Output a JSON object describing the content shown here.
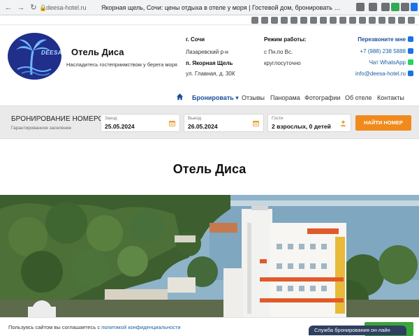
{
  "browser": {
    "url": "deesa-hotel.ru",
    "title": "Якорная щель, Сочи: цены отдыха в отеле у моря | Гостевой дом, бронировать пансион, стоимост..."
  },
  "brand": {
    "logo_text": "DEESA",
    "name": "Отель Диса",
    "tagline": "Насладитесь гостеприимством у берега моря"
  },
  "address": {
    "city": "г. Сочи",
    "district": "Лазаревский р-н",
    "village": "п. Якорная Щель",
    "street": "ул. Главная, д. 30К"
  },
  "hours": {
    "title": "Режим работы:",
    "days": "с Пн.по Вс.",
    "time": "круглосуточно"
  },
  "contacts": {
    "callback": "Перезвоните мне",
    "phone": "+7 (988) 238 5888",
    "whatsapp": "Чат WhatsApp",
    "email": "info@deesa-hotel.ru"
  },
  "menu": {
    "home_icon": "home-icon",
    "items": [
      "Бронировать",
      "Отзывы",
      "Панорама",
      "Фотографии",
      "Об отеле",
      "Контакты"
    ]
  },
  "booking": {
    "title": "БРОНИРОВАНИЕ НОМЕРОВ",
    "subtitle": "Гарантированное заселение",
    "checkin_label": "Заезд",
    "checkin_value": "25.05.2024",
    "checkout_label": "Выезд",
    "checkout_value": "26.05.2024",
    "guests_label": "Гости",
    "guests_value": "2 взрослых, 0 детей",
    "button": "НАЙТИ НОМЕР"
  },
  "page_title": "Отель Диса",
  "cookie": {
    "text": "Пользуясь сайтом вы соглашаетесь с ",
    "link": "политикой конфиденциальности"
  },
  "online_widget": "Служба бронирования он-лайн",
  "colors": {
    "accent": "#1a4e9a",
    "button": "#f08a1c",
    "logo_bg": "#1f2f8a",
    "whatsapp": "#25d366"
  }
}
